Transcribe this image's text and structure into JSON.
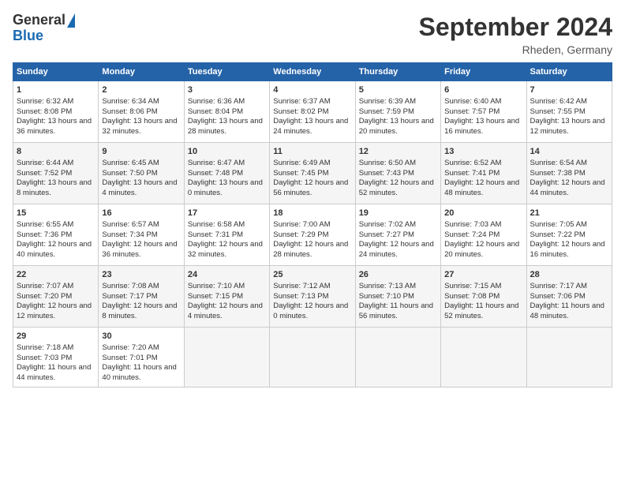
{
  "header": {
    "logo_general": "General",
    "logo_blue": "Blue",
    "month": "September 2024",
    "location": "Rheden, Germany"
  },
  "days_of_week": [
    "Sunday",
    "Monday",
    "Tuesday",
    "Wednesday",
    "Thursday",
    "Friday",
    "Saturday"
  ],
  "weeks": [
    [
      {
        "day": "1",
        "sunrise": "6:32 AM",
        "sunset": "8:08 PM",
        "daylight": "13 hours and 36 minutes."
      },
      {
        "day": "2",
        "sunrise": "6:34 AM",
        "sunset": "8:06 PM",
        "daylight": "13 hours and 32 minutes."
      },
      {
        "day": "3",
        "sunrise": "6:36 AM",
        "sunset": "8:04 PM",
        "daylight": "13 hours and 28 minutes."
      },
      {
        "day": "4",
        "sunrise": "6:37 AM",
        "sunset": "8:02 PM",
        "daylight": "13 hours and 24 minutes."
      },
      {
        "day": "5",
        "sunrise": "6:39 AM",
        "sunset": "7:59 PM",
        "daylight": "13 hours and 20 minutes."
      },
      {
        "day": "6",
        "sunrise": "6:40 AM",
        "sunset": "7:57 PM",
        "daylight": "13 hours and 16 minutes."
      },
      {
        "day": "7",
        "sunrise": "6:42 AM",
        "sunset": "7:55 PM",
        "daylight": "13 hours and 12 minutes."
      }
    ],
    [
      {
        "day": "8",
        "sunrise": "6:44 AM",
        "sunset": "7:52 PM",
        "daylight": "13 hours and 8 minutes."
      },
      {
        "day": "9",
        "sunrise": "6:45 AM",
        "sunset": "7:50 PM",
        "daylight": "13 hours and 4 minutes."
      },
      {
        "day": "10",
        "sunrise": "6:47 AM",
        "sunset": "7:48 PM",
        "daylight": "13 hours and 0 minutes."
      },
      {
        "day": "11",
        "sunrise": "6:49 AM",
        "sunset": "7:45 PM",
        "daylight": "12 hours and 56 minutes."
      },
      {
        "day": "12",
        "sunrise": "6:50 AM",
        "sunset": "7:43 PM",
        "daylight": "12 hours and 52 minutes."
      },
      {
        "day": "13",
        "sunrise": "6:52 AM",
        "sunset": "7:41 PM",
        "daylight": "12 hours and 48 minutes."
      },
      {
        "day": "14",
        "sunrise": "6:54 AM",
        "sunset": "7:38 PM",
        "daylight": "12 hours and 44 minutes."
      }
    ],
    [
      {
        "day": "15",
        "sunrise": "6:55 AM",
        "sunset": "7:36 PM",
        "daylight": "12 hours and 40 minutes."
      },
      {
        "day": "16",
        "sunrise": "6:57 AM",
        "sunset": "7:34 PM",
        "daylight": "12 hours and 36 minutes."
      },
      {
        "day": "17",
        "sunrise": "6:58 AM",
        "sunset": "7:31 PM",
        "daylight": "12 hours and 32 minutes."
      },
      {
        "day": "18",
        "sunrise": "7:00 AM",
        "sunset": "7:29 PM",
        "daylight": "12 hours and 28 minutes."
      },
      {
        "day": "19",
        "sunrise": "7:02 AM",
        "sunset": "7:27 PM",
        "daylight": "12 hours and 24 minutes."
      },
      {
        "day": "20",
        "sunrise": "7:03 AM",
        "sunset": "7:24 PM",
        "daylight": "12 hours and 20 minutes."
      },
      {
        "day": "21",
        "sunrise": "7:05 AM",
        "sunset": "7:22 PM",
        "daylight": "12 hours and 16 minutes."
      }
    ],
    [
      {
        "day": "22",
        "sunrise": "7:07 AM",
        "sunset": "7:20 PM",
        "daylight": "12 hours and 12 minutes."
      },
      {
        "day": "23",
        "sunrise": "7:08 AM",
        "sunset": "7:17 PM",
        "daylight": "12 hours and 8 minutes."
      },
      {
        "day": "24",
        "sunrise": "7:10 AM",
        "sunset": "7:15 PM",
        "daylight": "12 hours and 4 minutes."
      },
      {
        "day": "25",
        "sunrise": "7:12 AM",
        "sunset": "7:13 PM",
        "daylight": "12 hours and 0 minutes."
      },
      {
        "day": "26",
        "sunrise": "7:13 AM",
        "sunset": "7:10 PM",
        "daylight": "11 hours and 56 minutes."
      },
      {
        "day": "27",
        "sunrise": "7:15 AM",
        "sunset": "7:08 PM",
        "daylight": "11 hours and 52 minutes."
      },
      {
        "day": "28",
        "sunrise": "7:17 AM",
        "sunset": "7:06 PM",
        "daylight": "11 hours and 48 minutes."
      }
    ],
    [
      {
        "day": "29",
        "sunrise": "7:18 AM",
        "sunset": "7:03 PM",
        "daylight": "11 hours and 44 minutes."
      },
      {
        "day": "30",
        "sunrise": "7:20 AM",
        "sunset": "7:01 PM",
        "daylight": "11 hours and 40 minutes."
      },
      null,
      null,
      null,
      null,
      null
    ]
  ]
}
